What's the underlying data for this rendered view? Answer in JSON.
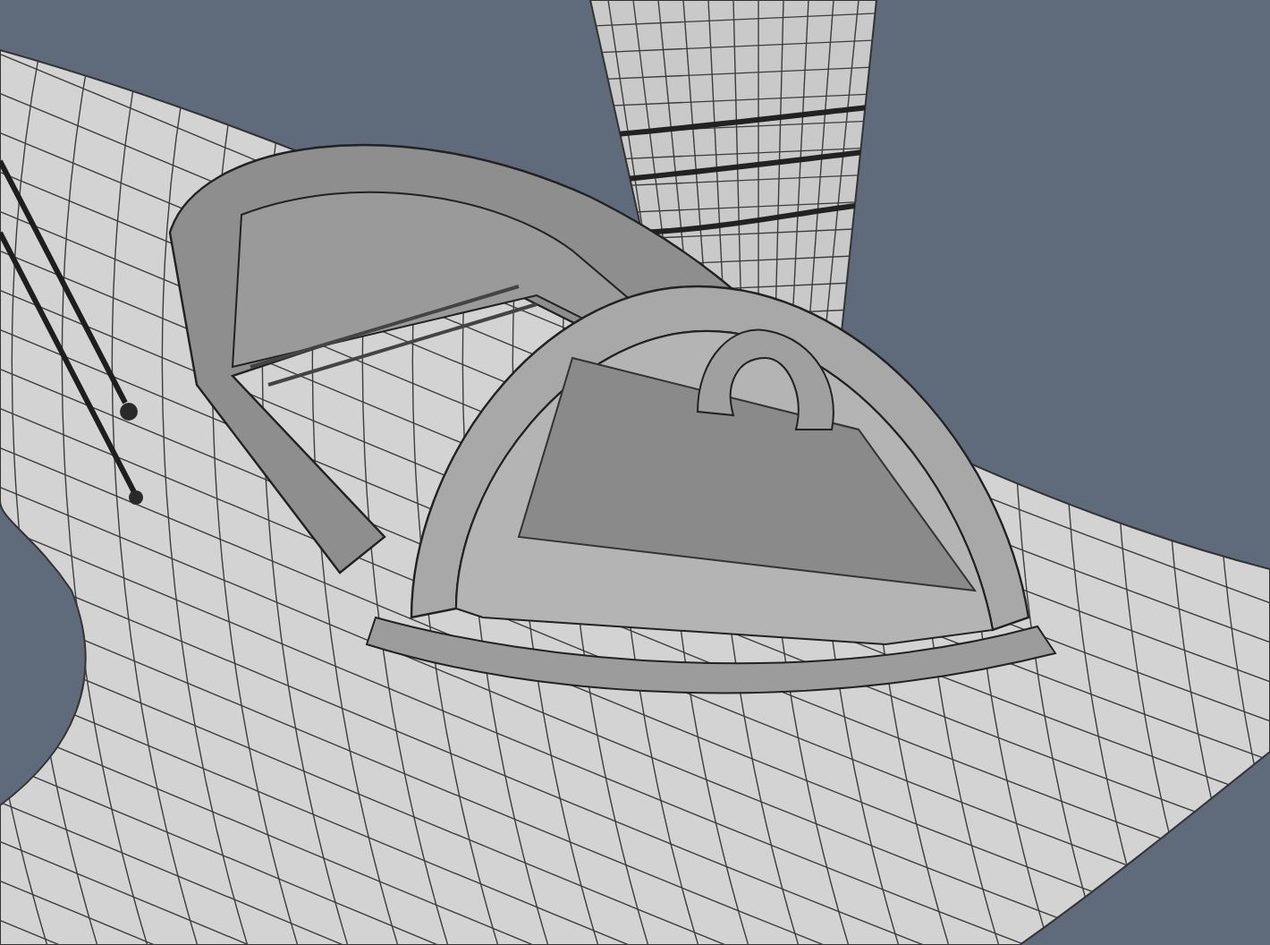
{
  "viewport": {
    "kind": "wireframe"
  }
}
